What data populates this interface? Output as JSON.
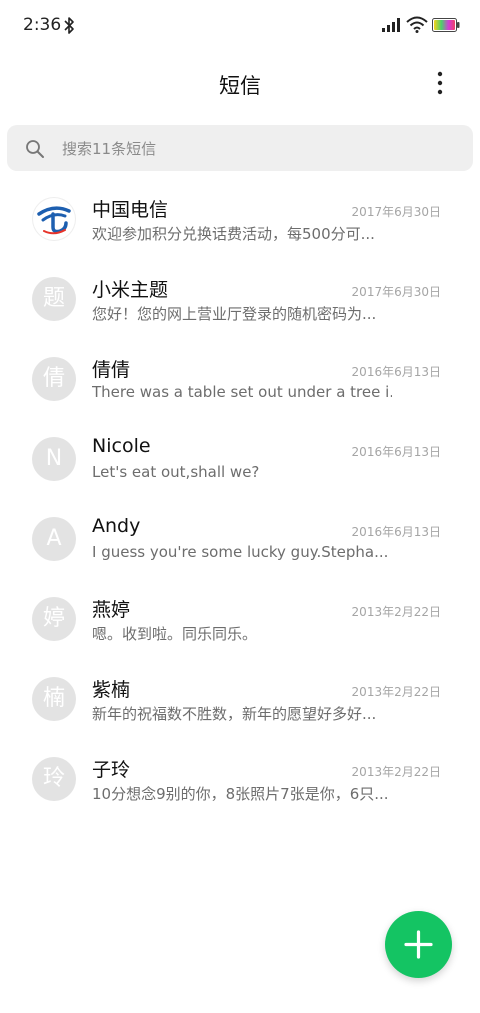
{
  "status_bar": {
    "time": "2:36",
    "icons": [
      "bluetooth-icon",
      "signal-icon",
      "wifi-icon",
      "battery-icon"
    ]
  },
  "header": {
    "title": "短信",
    "more_icon": "more-vertical-icon"
  },
  "search": {
    "placeholder": "搜索11条短信",
    "icon": "search-icon"
  },
  "messages": [
    {
      "avatar": "",
      "avatar_type": "china-telecom-logo",
      "sender": "中国电信",
      "preview": "欢迎参加积分兑换话费活动，每500分可...",
      "date": "2017年6月30日"
    },
    {
      "avatar": "题",
      "sender": "小米主题",
      "preview": "您好！您的网上营业厅登录的随机密码为...",
      "date": "2017年6月30日"
    },
    {
      "avatar": "倩",
      "sender": "倩倩",
      "preview": "There was a table set out under a tree i...",
      "date": "2016年6月13日"
    },
    {
      "avatar": "N",
      "sender": "Nicole",
      "preview": "Let's eat out,shall we?",
      "date": "2016年6月13日"
    },
    {
      "avatar": "A",
      "sender": "Andy",
      "preview": "I guess you're some lucky guy.Stepha...",
      "date": "2016年6月13日"
    },
    {
      "avatar": "婷",
      "sender": "燕婷",
      "preview": "嗯。收到啦。同乐同乐。",
      "date": "2013年2月22日"
    },
    {
      "avatar": "楠",
      "sender": "紫楠",
      "preview": "新年的祝福数不胜数，新年的愿望好多好...",
      "date": "2013年2月22日"
    },
    {
      "avatar": "玲",
      "sender": "子玲",
      "preview": "10分想念9别的你，8张照片7张是你，6只...",
      "date": "2013年2月22日"
    }
  ],
  "fab": {
    "icon": "plus-icon",
    "color": "#14c463"
  },
  "colors": {
    "accent": "#14c463",
    "avatar_bg": "#e3e3e3",
    "search_bg": "#efefef"
  }
}
